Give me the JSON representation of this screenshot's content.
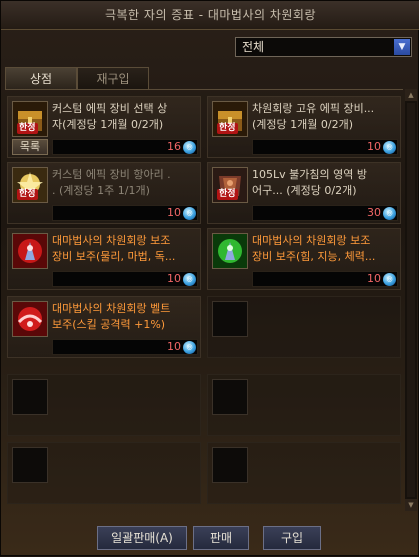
{
  "window": {
    "title": "극복한 자의 증표 - 대마법사의 차원회랑"
  },
  "filter": {
    "selected": "전체"
  },
  "tabs": [
    {
      "label": "상점"
    },
    {
      "label": "재구입"
    }
  ],
  "items": [
    {
      "color": "white",
      "line1": "커스텀 에픽 장비 선택 상",
      "line2": "자(계정당 1개월 0/2개)",
      "price": "16",
      "badge": "한정",
      "icon": "treasure-chest-icon",
      "list_label": "목록"
    },
    {
      "color": "white",
      "line1": "차원회랑 고유 에픽 장비...",
      "line2": "(계정당 1개월 0/2개)",
      "price": "10",
      "badge": "한정",
      "icon": "treasure-chest-icon"
    },
    {
      "color": "gray",
      "line1": "커스텀 에픽 장비 항아리 .",
      "line2": ". (계정당 1주 1/1개)",
      "price": "10",
      "badge": "한정",
      "icon": "jar-icon"
    },
    {
      "color": "white",
      "line1": "105Lv 불가침의 영역 방",
      "line2": "어구...   (계정당 0/2개)",
      "price": "30",
      "badge": "한정",
      "icon": "armor-box-icon"
    },
    {
      "color": "orange",
      "line1": "대마법사의 차원회랑 보조",
      "line2": "장비 보주(물리, 마법, 독...",
      "price": "10",
      "icon": "red-orb-icon"
    },
    {
      "color": "orange",
      "line1": "대마법사의 차원회랑 보조",
      "line2": "장비 보주(힘, 지능, 체력...",
      "price": "10",
      "icon": "green-orb-icon"
    },
    {
      "color": "orange",
      "line1": "대마법사의 차원회랑 벨트",
      "line2": "보주(스킬 공격력 +1%)",
      "price": "10",
      "icon": "red-belt-orb-icon"
    }
  ],
  "buttons": {
    "bulk_sell": "일괄판매(A)",
    "sell": "판매",
    "buy": "구입"
  },
  "colors": {
    "price": "#f06666",
    "epic_name": "#ff9a3a",
    "badge": "#b11414"
  }
}
